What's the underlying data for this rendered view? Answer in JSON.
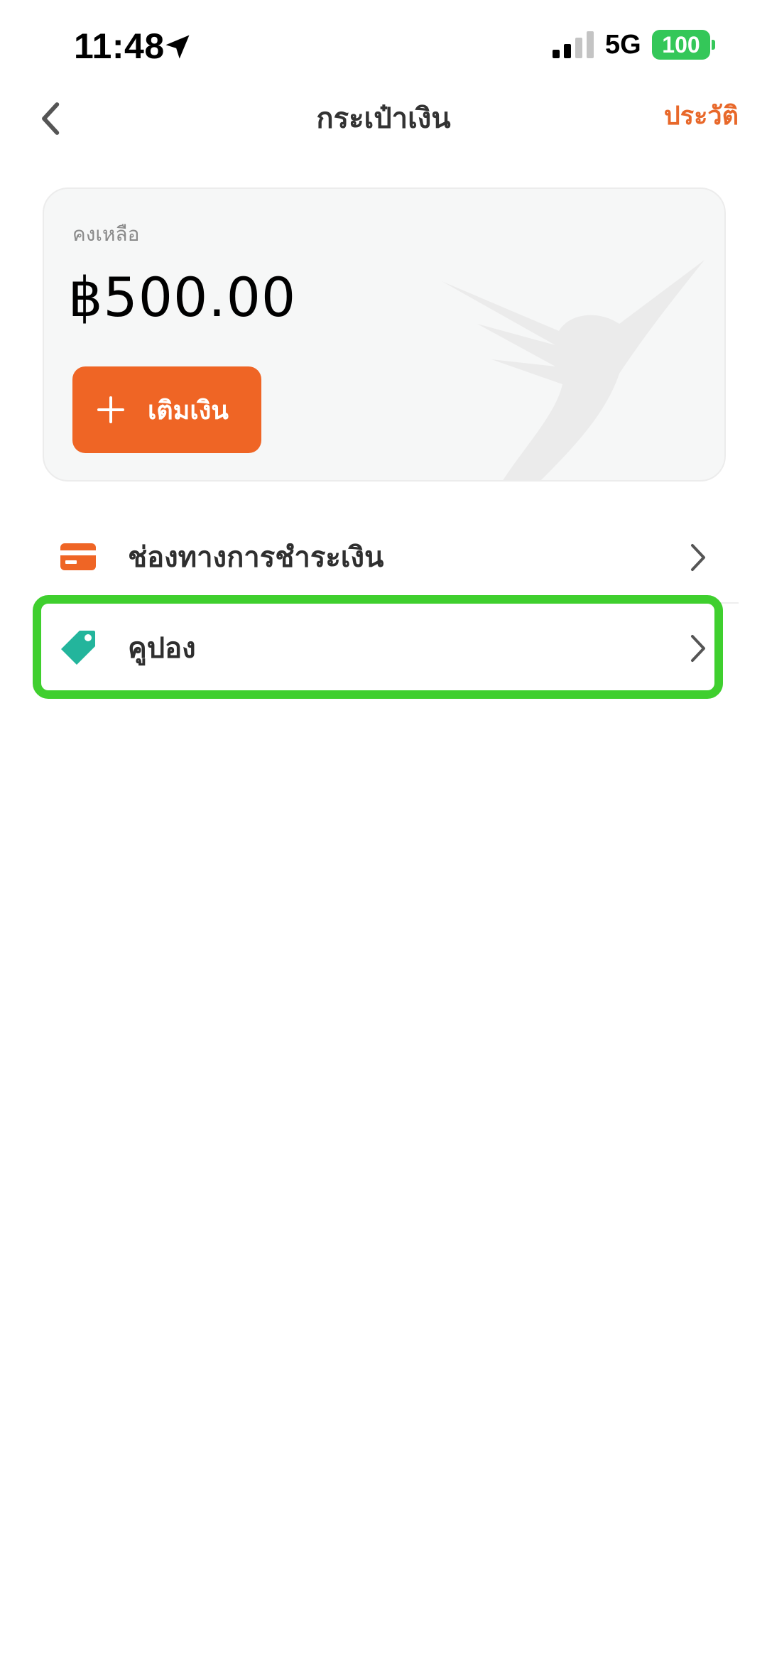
{
  "status_bar": {
    "time": "11:48",
    "network": "5G",
    "battery": "100",
    "icons": [
      "location-arrow-icon",
      "signal-icon"
    ]
  },
  "nav": {
    "title": "กระเป๋าเงิน",
    "history_label": "ประวัติ",
    "back_icon": "chevron-left-icon"
  },
  "wallet": {
    "balance_label": "คงเหลือ",
    "balance_amount": "฿500.00",
    "topup_label": "เติมเงิน"
  },
  "menu": {
    "items": [
      {
        "label": "ช่องทางการชำระเงิน",
        "icon": "credit-card-icon"
      },
      {
        "label": "คูปอง",
        "icon": "tag-icon"
      }
    ]
  },
  "colors": {
    "accent": "#ef6525",
    "tag": "#23b59c",
    "highlight": "#3fcf2e",
    "battery": "#34c759"
  }
}
